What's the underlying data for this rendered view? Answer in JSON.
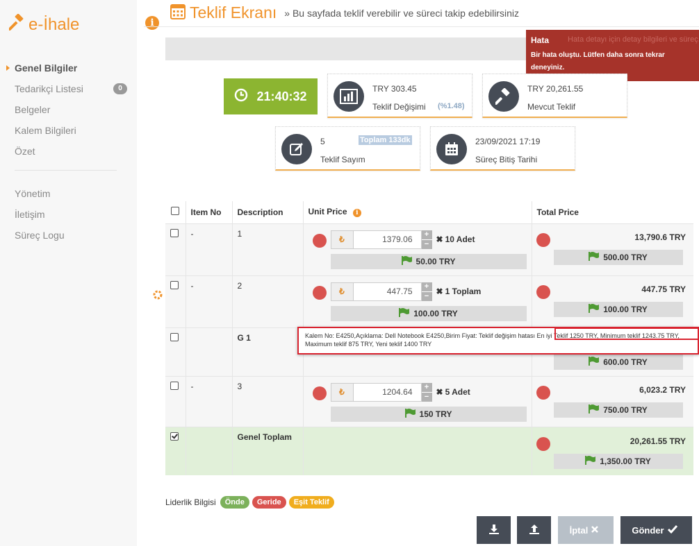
{
  "app": {
    "name": "e-İhale"
  },
  "sidebar": {
    "items": [
      {
        "label": "Genel Bilgiler",
        "active": true
      },
      {
        "label": "Tedarikçi Listesi",
        "badge": "0"
      },
      {
        "label": "Belgeler"
      },
      {
        "label": "Kalem Bilgileri"
      },
      {
        "label": "Özet"
      }
    ],
    "items2": [
      {
        "label": "Yönetim"
      },
      {
        "label": "İletişim"
      },
      {
        "label": "Süreç Logu"
      }
    ]
  },
  "header": {
    "title": "Teklif Ekranı",
    "subtitle": "» Bu sayfada teklif verebilir ve süreci takip edebilirsiniz"
  },
  "toast": {
    "ghost_text": "Hata detayı için detay bilgileri ve süreç...",
    "title": "Hata",
    "message": "Bir hata oluştu. Lütfen daha sonra tekrar deneyiniz."
  },
  "timer": {
    "value": "21:40:32"
  },
  "cards": {
    "change": {
      "value": "TRY 303.45",
      "label": "Teklif Değişimi",
      "percent": "(%1.48)",
      "icon": "chart-icon"
    },
    "current": {
      "value": "TRY 20,261.55",
      "label": "Mevcut Teklif",
      "icon": "gavel-icon"
    },
    "count": {
      "value": "5",
      "label": "Teklif Sayım",
      "badge": "Toplam 133dk",
      "icon": "edit-icon"
    },
    "end": {
      "value": "23/09/2021 17:19",
      "label": "Süreç Bitiş Tarihi",
      "icon": "calendar-icon"
    }
  },
  "table": {
    "headers": {
      "item_no": "Item No",
      "description": "Description",
      "unit_price": "Unit Price",
      "total_price": "Total Price"
    },
    "rows": [
      {
        "item_no": "-",
        "description": "1",
        "currency": "₺",
        "unit_price": "1379.06",
        "qty": "10 Adet",
        "unit_flag": "50.00 TRY",
        "total": "13,790.6 TRY",
        "total_flag": "500.00 TRY"
      },
      {
        "item_no": "-",
        "description": "2",
        "currency": "₺",
        "unit_price": "447.75",
        "qty": "1 Toplam",
        "unit_flag": "100.00 TRY",
        "total": "447.75 TRY",
        "total_flag": "100.00 TRY"
      },
      {
        "item_no": "",
        "description": "G 1",
        "total_flag": "600.00 TRY"
      },
      {
        "item_no": "-",
        "description": "3",
        "currency": "₺",
        "unit_price": "1204.64",
        "qty": "5 Adet",
        "unit_flag": "150 TRY",
        "total": "6,023.2 TRY",
        "total_flag": "750.00 TRY"
      }
    ],
    "total_row": {
      "label": "Genel Toplam",
      "total": "20,261.55 TRY",
      "total_flag": "1,350.00 TRY"
    }
  },
  "tooltip": {
    "text": "Kalem No: E4250,Açıklama: Dell Notebook E4250,Birim Fiyat: Teklif değişim hatası En iyi Teklif 1250 TRY, Minimum teklif 1243.75 TRY, Maximum teklif 875 TRY, Yeni teklif 1400 TRY"
  },
  "legend": {
    "label": "Liderlik Bilgisi",
    "items": [
      {
        "label": "Önde",
        "color": "#7cb15b"
      },
      {
        "label": "Geride",
        "color": "#d9534f"
      },
      {
        "label": "Eşit Teklif",
        "color": "#f0ad1e"
      }
    ]
  },
  "buttons": {
    "cancel": "İptal",
    "send": "Gönder"
  },
  "colors": {
    "accent": "#f0932b",
    "timer": "#8cb531",
    "danger": "#d9534f",
    "dark": "#464c56",
    "toast": "#a6332a",
    "total_row": "#e1f0d9"
  }
}
